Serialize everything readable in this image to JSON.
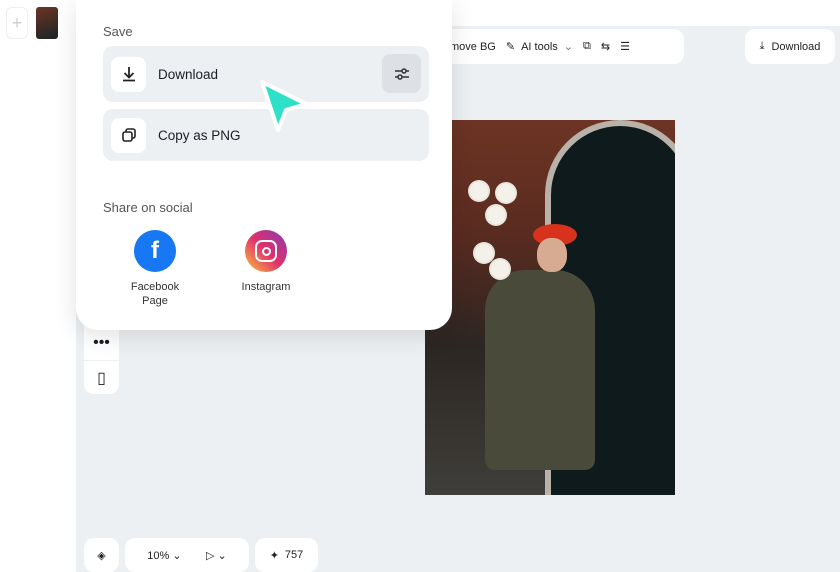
{
  "toolbar": {
    "remove_bg": "move BG",
    "ai_tools": "AI tools",
    "download": "Download"
  },
  "bottom": {
    "zoom": "10%",
    "credits": "757"
  },
  "popup": {
    "save_heading": "Save",
    "download": "Download",
    "copy_png": "Copy as PNG",
    "share_heading": "Share on social",
    "facebook": "Facebook Page",
    "instagram": "Instagram"
  },
  "colors": {
    "accent": "#2ee0c8",
    "facebook": "#1877f2",
    "canvas": "#edf0f3"
  }
}
